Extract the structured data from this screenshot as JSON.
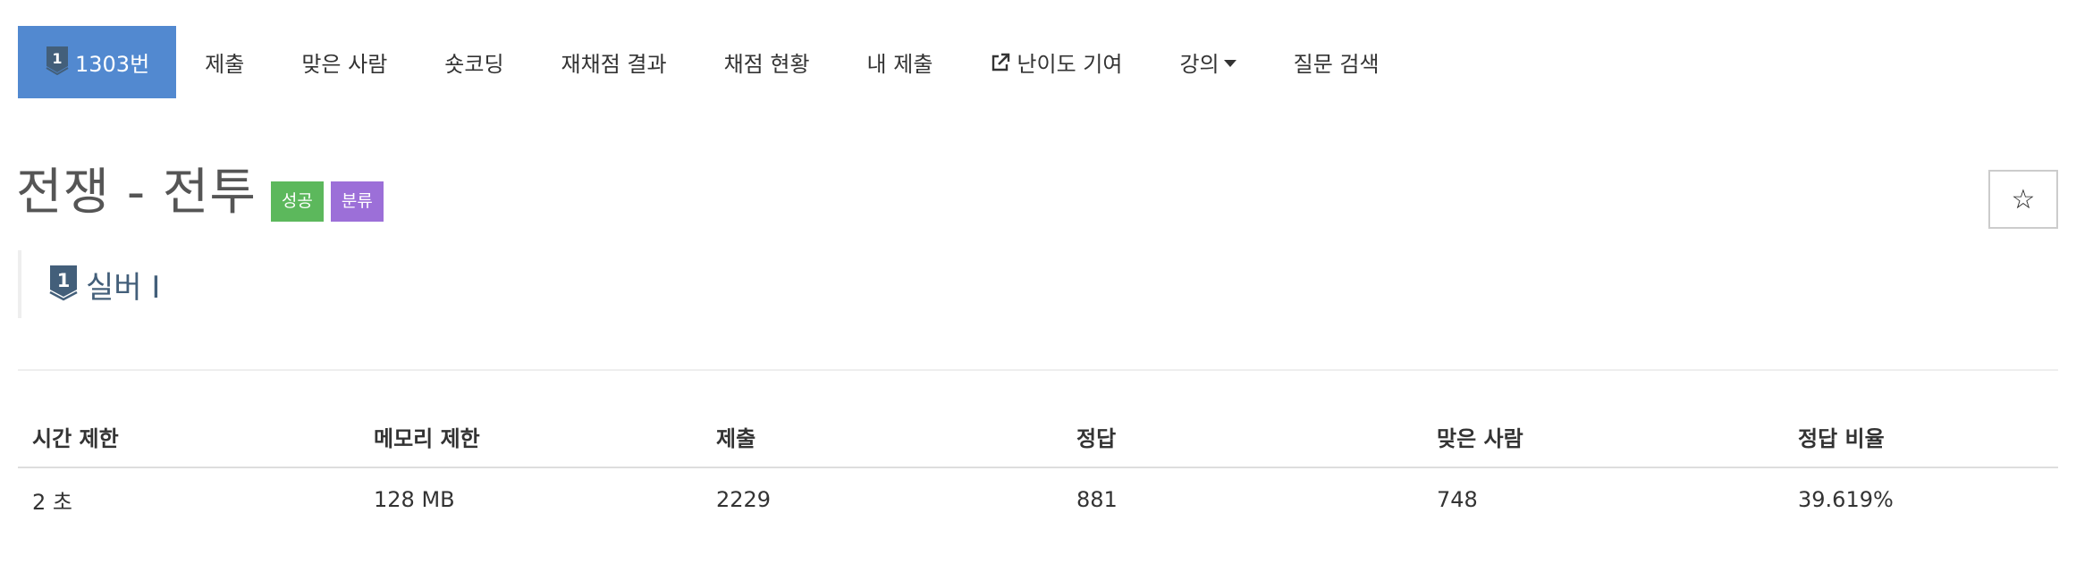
{
  "nav": {
    "problem_number": "1303번",
    "items": [
      {
        "label": "제출"
      },
      {
        "label": "맞은 사람"
      },
      {
        "label": "숏코딩"
      },
      {
        "label": "재채점 결과"
      },
      {
        "label": "채점 현황"
      },
      {
        "label": "내 제출"
      },
      {
        "label": "난이도 기여",
        "icon": "external-link-icon"
      },
      {
        "label": "강의",
        "icon": "caret-down-icon"
      },
      {
        "label": "질문 검색"
      }
    ]
  },
  "problem": {
    "title": "전쟁 - 전투",
    "labels": {
      "success": "성공",
      "category": "분류"
    },
    "star": "☆",
    "tier": {
      "level": "1",
      "name": "실버 I",
      "icon": "silver-tier-icon"
    }
  },
  "info_table": {
    "headers": [
      "시간 제한",
      "메모리 제한",
      "제출",
      "정답",
      "맞은 사람",
      "정답 비율"
    ],
    "row": [
      "2 초",
      "128 MB",
      "2229",
      "881",
      "748",
      "39.619%"
    ]
  },
  "colors": {
    "nav_active": "#5289d0",
    "label_success": "#5cb85c",
    "label_category": "#9c6fd8",
    "tier_silver": "#435f7a"
  }
}
